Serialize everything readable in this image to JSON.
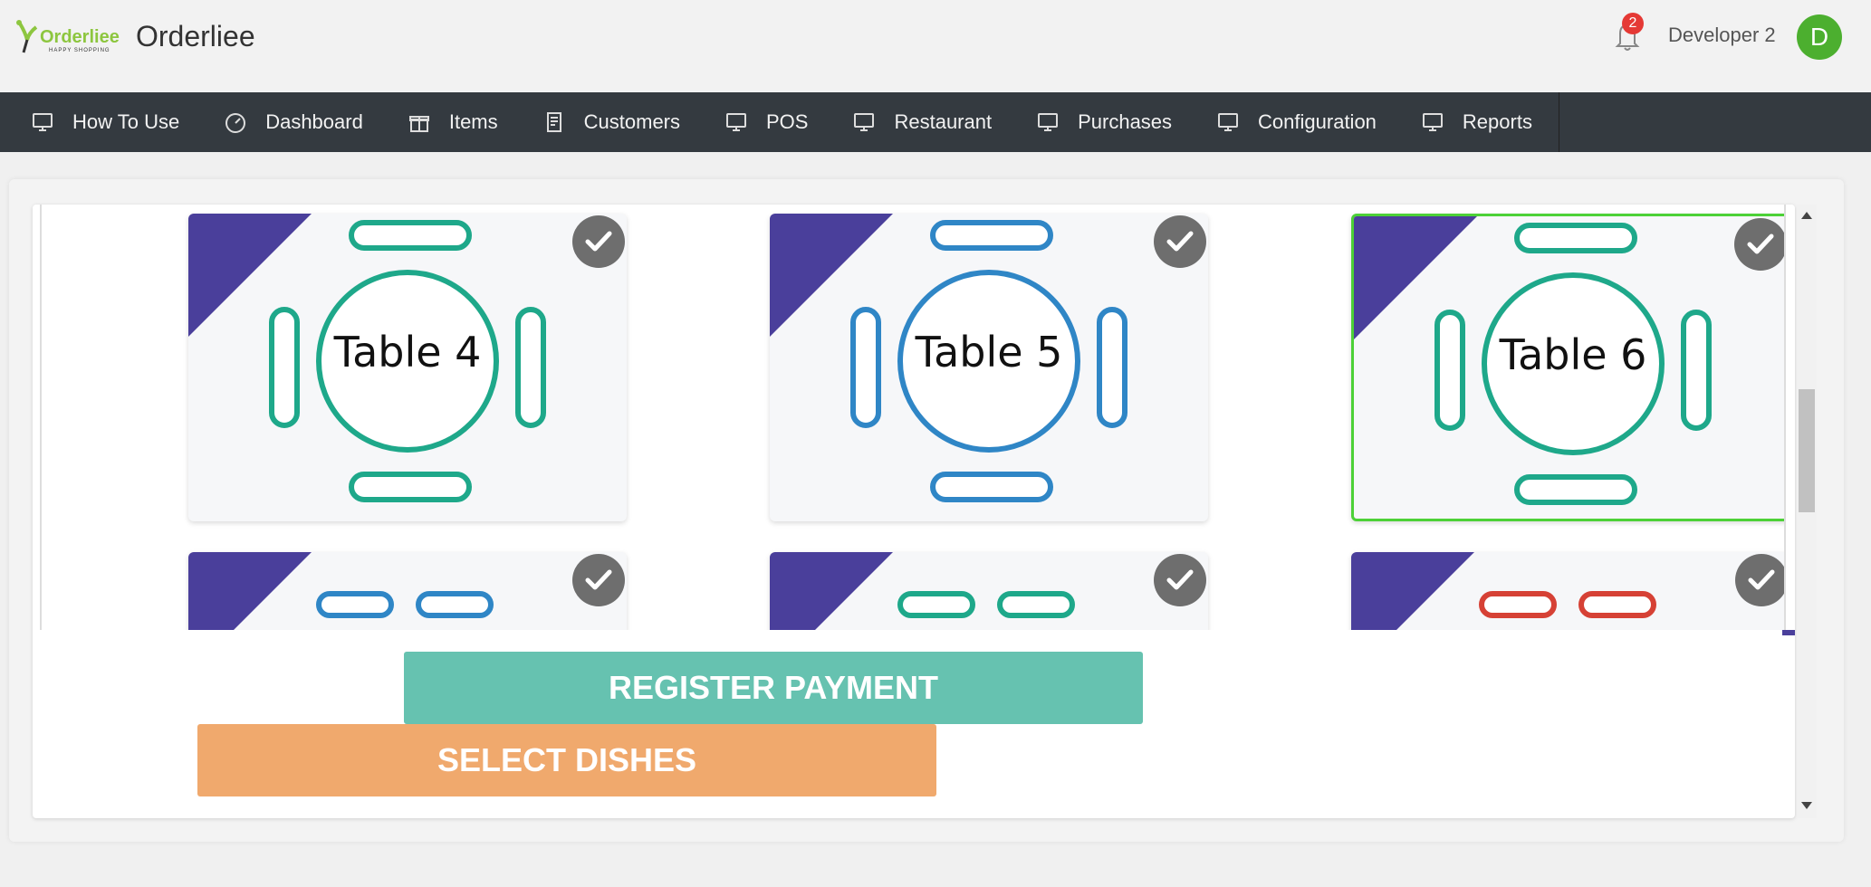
{
  "header": {
    "logo_text": "Orderliee",
    "logo_subtext": "HAPPY SHOPPING",
    "app_name": "Orderliee",
    "notification_count": "2",
    "user_name": "Developer 2",
    "avatar_initial": "D"
  },
  "nav": {
    "items": [
      {
        "label": "How To Use",
        "icon": "monitor-icon"
      },
      {
        "label": "Dashboard",
        "icon": "dashboard-icon"
      },
      {
        "label": "Items",
        "icon": "gift-icon"
      },
      {
        "label": "Customers",
        "icon": "customers-icon"
      },
      {
        "label": "POS",
        "icon": "monitor-icon"
      },
      {
        "label": "Restaurant",
        "icon": "monitor-icon"
      },
      {
        "label": "Purchases",
        "icon": "monitor-icon"
      },
      {
        "label": "Configuration",
        "icon": "monitor-icon"
      },
      {
        "label": "Reports",
        "icon": "monitor-icon"
      }
    ]
  },
  "tables": [
    {
      "label": "Table 4",
      "color": "#1ea88a",
      "selected": false
    },
    {
      "label": "Table 5",
      "color": "#2f86c6",
      "selected": false
    },
    {
      "label": "Table 6",
      "color": "#1ea88a",
      "selected": true
    },
    {
      "label": "",
      "color": "#2f86c6",
      "selected": false
    },
    {
      "label": "",
      "color": "#1ea88a",
      "selected": false
    },
    {
      "label": "",
      "color": "#d64135",
      "selected": false
    }
  ],
  "actions": {
    "register_payment": "REGISTER PAYMENT",
    "select_dishes": "SELECT DISHES"
  },
  "colors": {
    "corner": "#4a3f9b",
    "selected_border": "#4cd137",
    "register": "#66c2b0",
    "dishes": "#f0a96d",
    "nav_bg": "#343a40"
  }
}
